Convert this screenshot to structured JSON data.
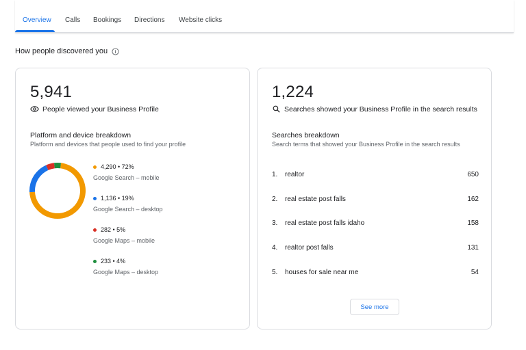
{
  "tabs": [
    {
      "label": "Overview",
      "active": true
    },
    {
      "label": "Calls"
    },
    {
      "label": "Bookings"
    },
    {
      "label": "Directions"
    },
    {
      "label": "Website clicks"
    }
  ],
  "section": {
    "title": "How people discovered you",
    "info_icon": "info-icon"
  },
  "left_card": {
    "total": "5,941",
    "metric_icon": "eye-icon",
    "metric_label": "People viewed your Business Profile",
    "breakdown_title": "Platform and device breakdown",
    "breakdown_desc": "Platform and devices that people used to find your profile",
    "legend": [
      {
        "value": "4,290 • 72%",
        "label": "Google Search – mobile",
        "color": "#f29900"
      },
      {
        "value": "1,136 • 19%",
        "label": "Google Search – desktop",
        "color": "#1a73e8"
      },
      {
        "value": "282 • 5%",
        "label": "Google Maps – mobile",
        "color": "#d93025"
      },
      {
        "value": "233 • 4%",
        "label": "Google Maps – desktop",
        "color": "#1e8e3e"
      }
    ]
  },
  "right_card": {
    "total": "1,224",
    "metric_icon": "search-icon",
    "metric_label": "Searches showed your Business Profile in the search results",
    "breakdown_title": "Searches breakdown",
    "breakdown_desc": "Search terms that showed your Business Profile in the search results",
    "searches": [
      {
        "rank": "1.",
        "term": "realtor",
        "count": "650"
      },
      {
        "rank": "2.",
        "term": "real estate post falls",
        "count": "162"
      },
      {
        "rank": "3.",
        "term": "real estate post falls idaho",
        "count": "158"
      },
      {
        "rank": "4.",
        "term": "realtor post falls",
        "count": "131"
      },
      {
        "rank": "5.",
        "term": "houses for sale near me",
        "count": "54"
      }
    ],
    "see_more_label": "See more"
  },
  "chart_data": {
    "type": "pie",
    "categories": [
      "Google Search – mobile",
      "Google Search – desktop",
      "Google Maps – mobile",
      "Google Maps – desktop"
    ],
    "values": [
      4290,
      1136,
      282,
      233
    ],
    "colors": [
      "#f29900",
      "#1a73e8",
      "#d93025",
      "#1e8e3e"
    ]
  }
}
